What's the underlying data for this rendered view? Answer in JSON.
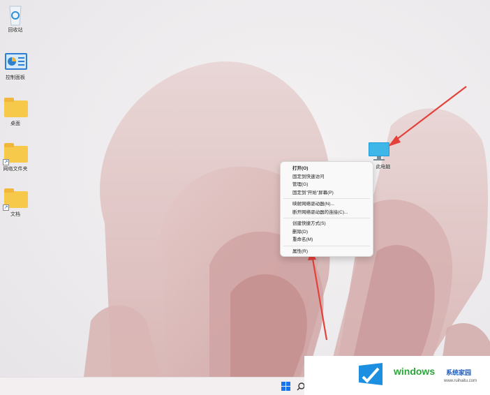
{
  "desktop_icons": [
    {
      "label": "回收站",
      "icon": "recycle-bin-icon"
    },
    {
      "label": "控制面板",
      "icon": "control-panel-icon"
    },
    {
      "label": "桌面",
      "icon": "folder-icon"
    },
    {
      "label": "网络文件夹",
      "icon": "folder-shortcut-icon"
    },
    {
      "label": "文档",
      "icon": "folder-shortcut-icon"
    },
    {
      "label": "此电脑",
      "icon": "monitor-icon"
    }
  ],
  "context_menu": {
    "group1": [
      "打开(O)",
      "固定到快速访问",
      "管理(G)",
      "固定到\"开始\"屏幕(P)"
    ],
    "group2": [
      "映射网络驱动器(N)...",
      "断开网络驱动器的连接(C)..."
    ],
    "group3": [
      "创建快捷方式(S)",
      "删除(D)",
      "重命名(M)"
    ],
    "group4": [
      "属性(R)"
    ]
  },
  "taskbar": {
    "start_icon": "windows-start-icon",
    "search_icon": "search-icon"
  },
  "watermark": {
    "brand": "windows",
    "brand_suffix": "系统家园",
    "url": "www.ruihaitu.com"
  },
  "colors": {
    "arrow": "#e3413a",
    "accent": "#1a73e8",
    "brand_blue": "#1d5dbd",
    "brand_green": "#2aa63a"
  }
}
